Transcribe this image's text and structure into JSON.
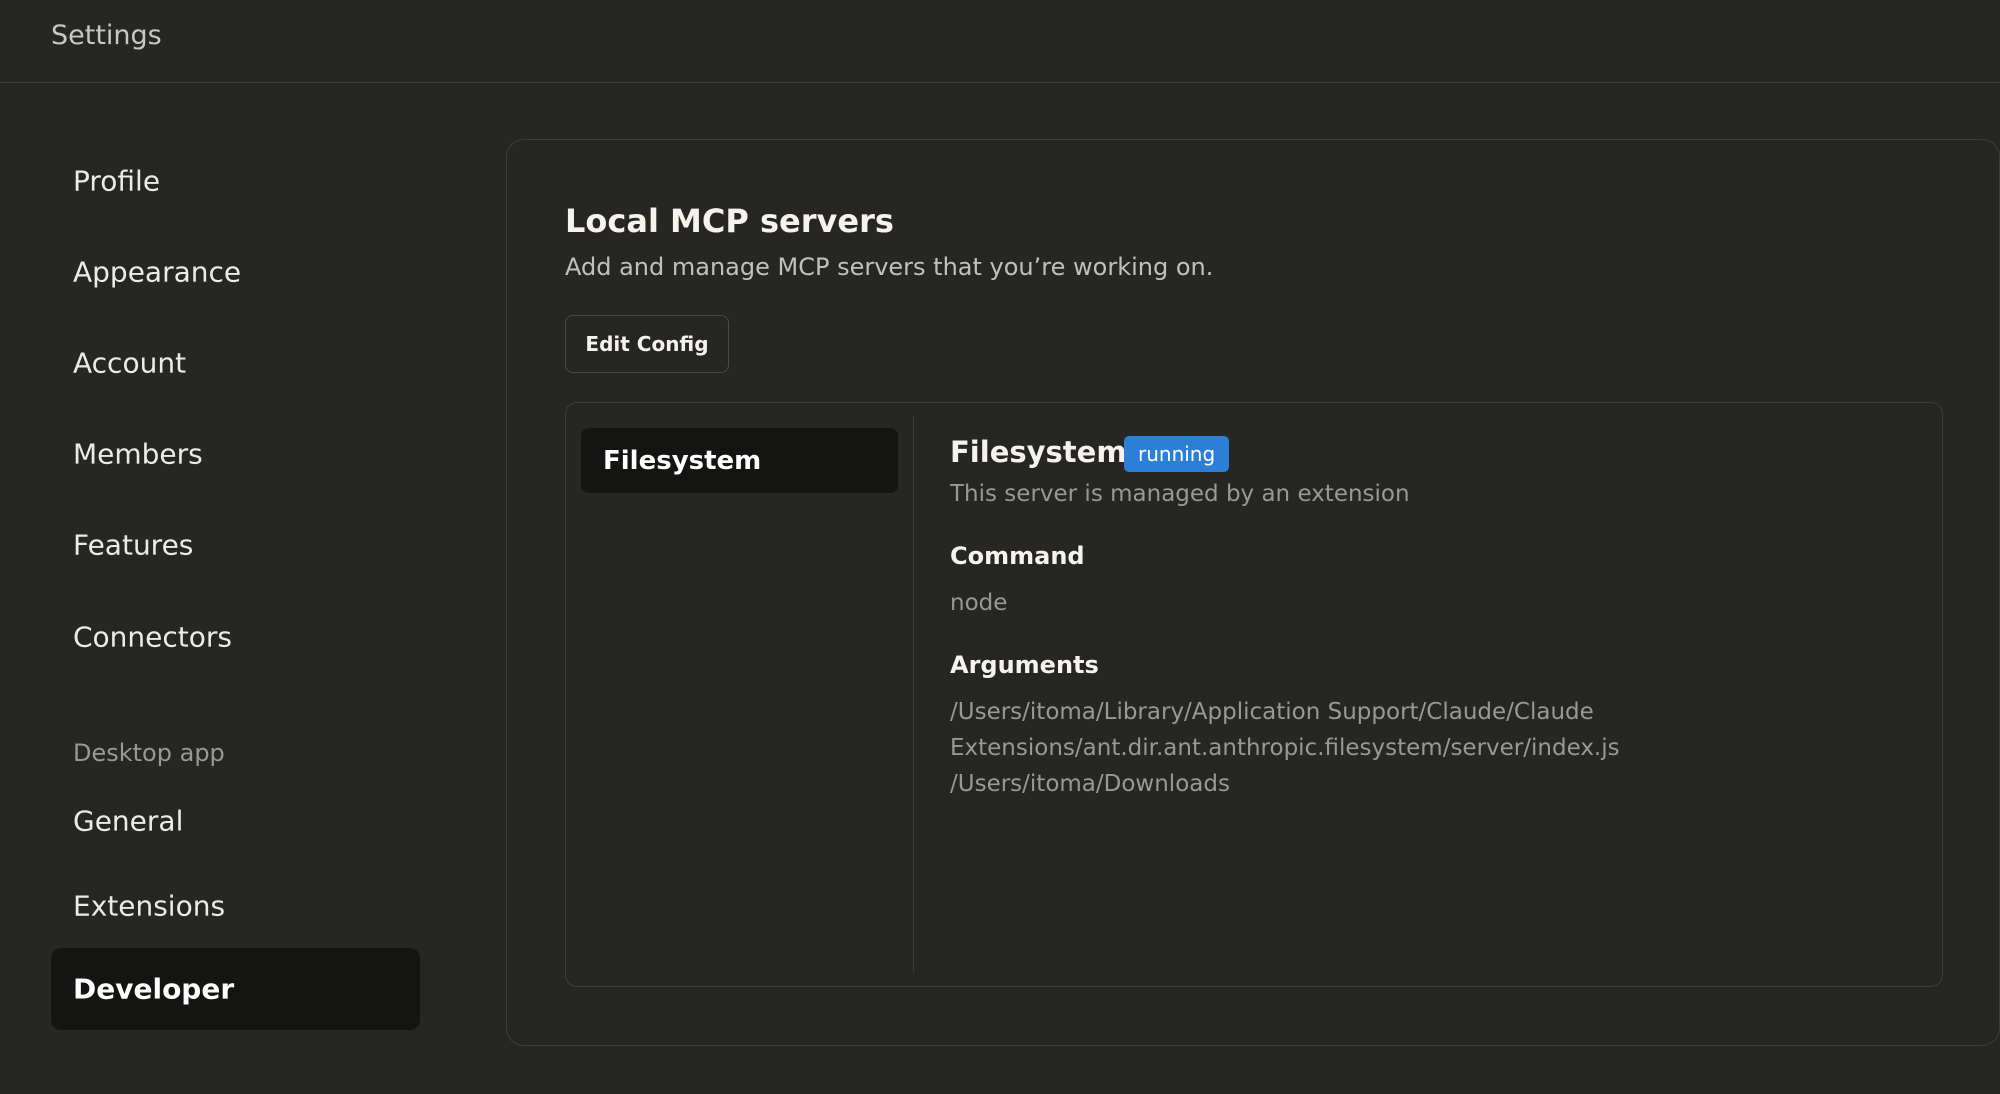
{
  "header": {
    "title": "Settings"
  },
  "sidebar": {
    "items": [
      {
        "label": "Profile"
      },
      {
        "label": "Appearance"
      },
      {
        "label": "Account"
      },
      {
        "label": "Members"
      },
      {
        "label": "Features"
      },
      {
        "label": "Connectors"
      }
    ],
    "section_label": "Desktop app",
    "desktop_items": [
      {
        "label": "General"
      },
      {
        "label": "Extensions"
      },
      {
        "label": "Developer"
      }
    ],
    "active_item": "Developer"
  },
  "main": {
    "title": "Local MCP servers",
    "description": "Add and manage MCP servers that you’re working on.",
    "edit_config_label": "Edit Config",
    "servers": [
      {
        "name": "Filesystem"
      }
    ],
    "selected_server": {
      "name": "Filesystem",
      "status": "running",
      "status_color": "#2b7fd6",
      "subtitle": "This server is managed by an extension",
      "command_label": "Command",
      "command": "node",
      "arguments_label": "Arguments",
      "arguments_lines": [
        "/Users/itoma/Library/Application Support/Claude/Claude",
        "Extensions/ant.dir.ant.anthropic.filesystem/server/index.js",
        "/Users/itoma/Downloads"
      ]
    }
  },
  "colors": {
    "background": "#262624",
    "active_bg": "#141413",
    "border": "#3d3d3a",
    "muted_text": "#9a9891"
  }
}
